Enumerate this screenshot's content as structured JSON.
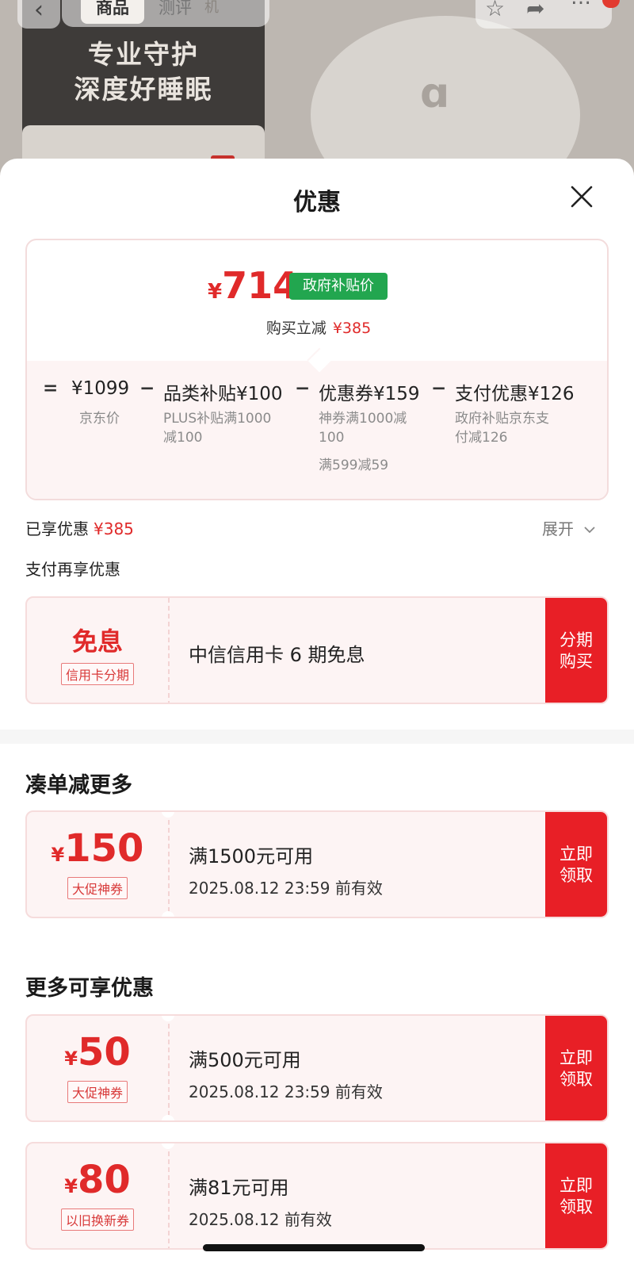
{
  "background": {
    "tabs": [
      "商品",
      "测评"
    ],
    "tab_faint": "机",
    "slogan_line1": "专业守护",
    "slogan_line2": "深度好睡眠",
    "device_logo": "ɑ"
  },
  "sheet": {
    "title": "优惠",
    "close_icon": "close-icon"
  },
  "price_summary": {
    "currency": "¥",
    "price": "714",
    "price_tag": "政府补贴价",
    "save_label": "购买立减",
    "save_amount": "¥385",
    "formula": {
      "eq": "=",
      "minus": "−",
      "jd_price": "¥1099",
      "jd_label": "京东价",
      "category_label": "品类补贴¥100",
      "category_detail_1": "PLUS补贴满1000",
      "category_detail_2": "减100",
      "coupon_label": "优惠券¥159",
      "coupon_detail_1": "神券满1000减",
      "coupon_detail_2": "100",
      "coupon_detail_3": "满599减59",
      "pay_label": "支付优惠¥126",
      "pay_detail_1": "政府补贴京东支",
      "pay_detail_2": "付减126"
    }
  },
  "applied": {
    "label": "已享优惠",
    "amount": "¥385",
    "expand_label": "展开"
  },
  "pay_offers": {
    "heading": "支付再享优惠",
    "card": {
      "value": "免息",
      "tag": "信用卡分期",
      "main": "中信信用卡 6 期免息",
      "button_line1": "分期",
      "button_line2": "购买"
    }
  },
  "bundle": {
    "heading": "凑单减更多",
    "coupon": {
      "currency": "¥",
      "value": "150",
      "tag": "大促神券",
      "main": "满1500元可用",
      "sub": "2025.08.12 23:59 前有效",
      "button_line1": "立即",
      "button_line2": "领取"
    }
  },
  "more": {
    "heading": "更多可享优惠",
    "coupons": [
      {
        "currency": "¥",
        "value": "50",
        "tag": "大促神券",
        "main": "满500元可用",
        "sub": "2025.08.12 23:59 前有效",
        "button_line1": "立即",
        "button_line2": "领取"
      },
      {
        "currency": "¥",
        "value": "80",
        "tag": "以旧换新券",
        "main": "满81元可用",
        "sub": "2025.08.12 前有效",
        "button_line1": "立即",
        "button_line2": "领取"
      }
    ]
  },
  "colors": {
    "accent_red": "#e02a2a",
    "button_red": "#e81f26",
    "gov_green": "#22a64f"
  }
}
